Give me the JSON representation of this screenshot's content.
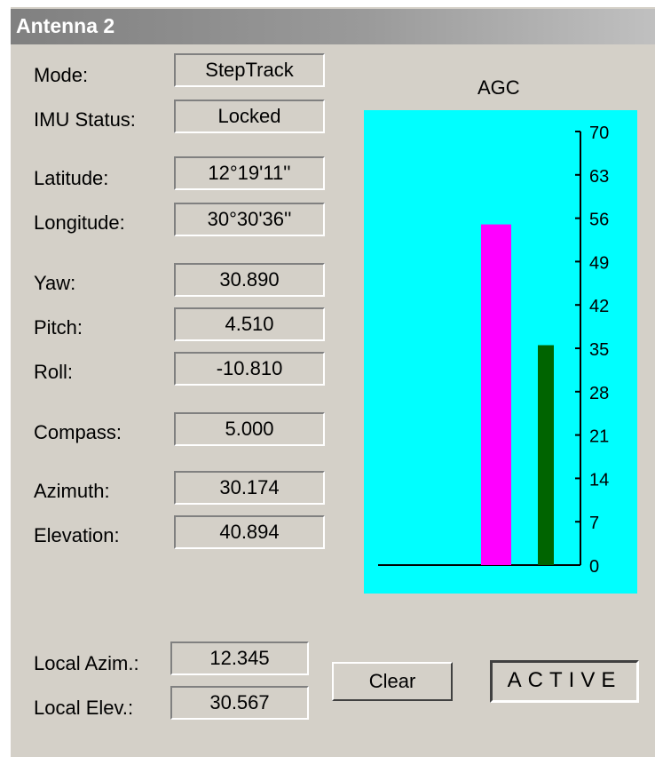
{
  "window": {
    "title": "Antenna 2"
  },
  "fields": {
    "mode": {
      "label": "Mode:",
      "value": "StepTrack"
    },
    "imu_status": {
      "label": "IMU Status:",
      "value": "Locked"
    },
    "latitude": {
      "label": "Latitude:",
      "value": "12°19'11''"
    },
    "longitude": {
      "label": "Longitude:",
      "value": "30°30'36''"
    },
    "yaw": {
      "label": "Yaw:",
      "value": "30.890"
    },
    "pitch": {
      "label": "Pitch:",
      "value": "4.510"
    },
    "roll": {
      "label": "Roll:",
      "value": "-10.810"
    },
    "compass": {
      "label": "Compass:",
      "value": "5.000"
    },
    "azimuth": {
      "label": "Azimuth:",
      "value": "30.174"
    },
    "elevation": {
      "label": "Elevation:",
      "value": "40.894"
    },
    "local_azim": {
      "label": "Local Azim.:",
      "value": "12.345"
    },
    "local_elev": {
      "label": "Local Elev.:",
      "value": "30.567"
    }
  },
  "buttons": {
    "clear": "Clear"
  },
  "status": {
    "active": "ACTIVE"
  },
  "chart_data": {
    "type": "bar",
    "title": "AGC",
    "ylim": [
      0,
      70
    ],
    "yticks": [
      0,
      7,
      14,
      21,
      28,
      35,
      42,
      49,
      56,
      63,
      70
    ],
    "series": [
      {
        "values": [
          55
        ],
        "color": "#ff00ff"
      },
      {
        "values": [
          35.5
        ],
        "color": "#006400"
      }
    ],
    "background": "#00ffff",
    "axis_color": "#000000",
    "grid": false
  }
}
